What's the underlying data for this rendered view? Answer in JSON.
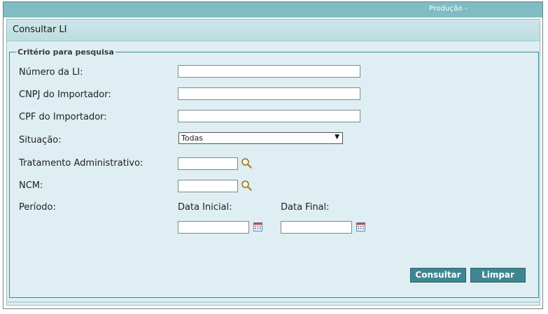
{
  "topbar": {
    "environment": "Produção -"
  },
  "panel": {
    "title": "Consultar LI"
  },
  "criteria": {
    "legend": "Critério para pesquisa",
    "numero_li": {
      "label": "Número da LI:",
      "value": ""
    },
    "cnpj": {
      "label": "CNPJ do Importador:",
      "value": ""
    },
    "cpf": {
      "label": "CPF do Importador:",
      "value": ""
    },
    "situacao": {
      "label": "Situação:",
      "selected": "Todas"
    },
    "tratamento": {
      "label": "Tratamento Administrativo:",
      "value": ""
    },
    "ncm": {
      "label": "NCM:",
      "value": ""
    },
    "periodo": {
      "label": "Período:",
      "data_inicial_label": "Data Inicial:",
      "data_final_label": "Data Final:",
      "data_inicial": "",
      "data_final": ""
    }
  },
  "buttons": {
    "consultar": "Consultar",
    "limpar": "Limpar"
  },
  "icons": {
    "lookup": "magnifier-icon",
    "calendar": "calendar-icon"
  },
  "colors": {
    "header_bar": "#7fbcc4",
    "panel_bg": "#dfeef2",
    "button": "#3f8790"
  }
}
